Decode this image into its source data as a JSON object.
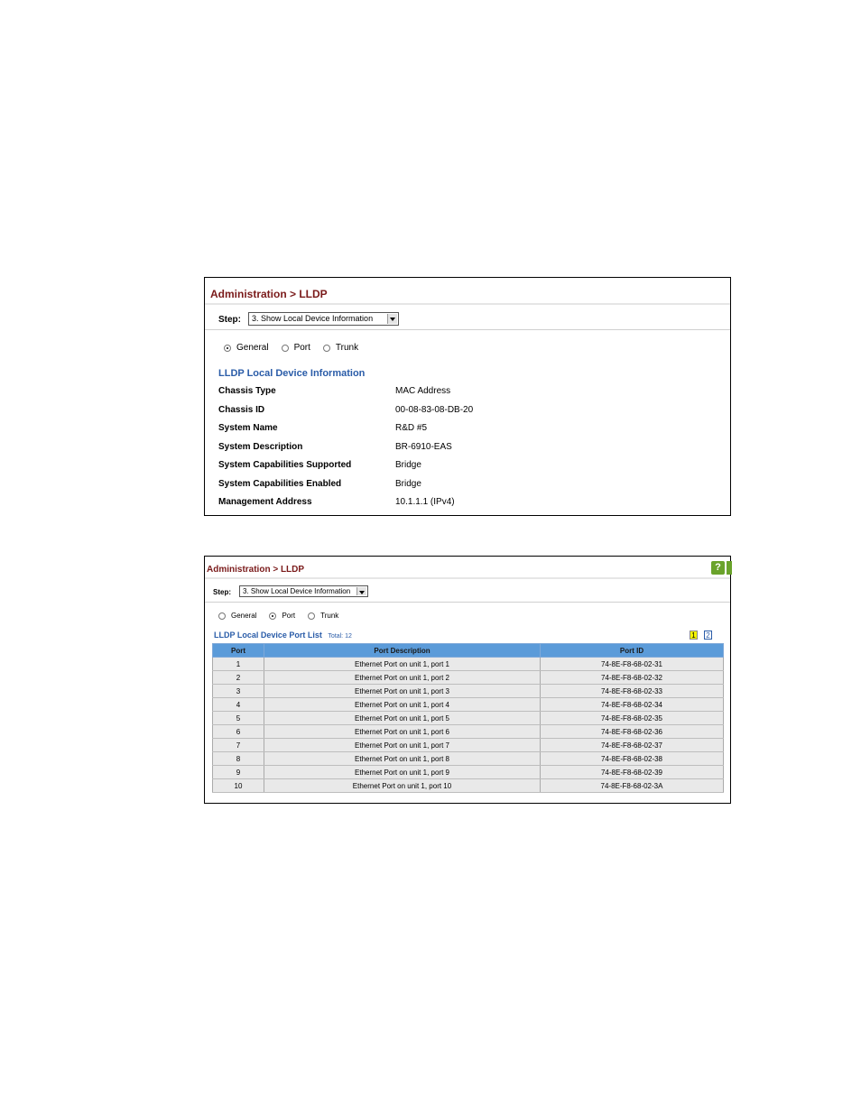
{
  "panel1": {
    "title": "Administration > LLDP",
    "step_label": "Step:",
    "step_value": "3. Show Local Device Information",
    "radios": [
      {
        "label": "General",
        "checked": true
      },
      {
        "label": "Port",
        "checked": false
      },
      {
        "label": "Trunk",
        "checked": false
      }
    ],
    "section_title": "LLDP Local Device Information",
    "rows": [
      {
        "key": "Chassis Type",
        "value": "MAC Address"
      },
      {
        "key": "Chassis ID",
        "value": "00-08-83-08-DB-20"
      },
      {
        "key": "System Name",
        "value": "R&D #5"
      },
      {
        "key": "System Description",
        "value": "BR-6910-EAS"
      },
      {
        "key": "System Capabilities Supported",
        "value": "Bridge"
      },
      {
        "key": "System Capabilities Enabled",
        "value": "Bridge"
      },
      {
        "key": "Management Address",
        "value": "10.1.1.1 (IPv4)"
      }
    ]
  },
  "panel2": {
    "title": "Administration > LLDP",
    "help_icon": "question-icon",
    "step_label": "Step:",
    "step_value": "3. Show Local Device Information",
    "radios": [
      {
        "label": "General",
        "checked": false
      },
      {
        "label": "Port",
        "checked": true
      },
      {
        "label": "Trunk",
        "checked": false
      }
    ],
    "list_title": "LLDP Local Device Port List",
    "total": "Total: 12",
    "pages": [
      "1",
      "2"
    ],
    "columns": [
      "Port",
      "Port Description",
      "Port ID"
    ],
    "rows": [
      [
        "1",
        "Ethernet Port on unit 1, port 1",
        "74-8E-F8-68-02-31"
      ],
      [
        "2",
        "Ethernet Port on unit 1, port 2",
        "74-8E-F8-68-02-32"
      ],
      [
        "3",
        "Ethernet Port on unit 1, port 3",
        "74-8E-F8-68-02-33"
      ],
      [
        "4",
        "Ethernet Port on unit 1, port 4",
        "74-8E-F8-68-02-34"
      ],
      [
        "5",
        "Ethernet Port on unit 1, port 5",
        "74-8E-F8-68-02-35"
      ],
      [
        "6",
        "Ethernet Port on unit 1, port 6",
        "74-8E-F8-68-02-36"
      ],
      [
        "7",
        "Ethernet Port on unit 1, port 7",
        "74-8E-F8-68-02-37"
      ],
      [
        "8",
        "Ethernet Port on unit 1, port 8",
        "74-8E-F8-68-02-38"
      ],
      [
        "9",
        "Ethernet Port on unit 1, port 9",
        "74-8E-F8-68-02-39"
      ],
      [
        "10",
        "Ethernet Port on unit 1, port 10",
        "74-8E-F8-68-02-3A"
      ]
    ]
  }
}
